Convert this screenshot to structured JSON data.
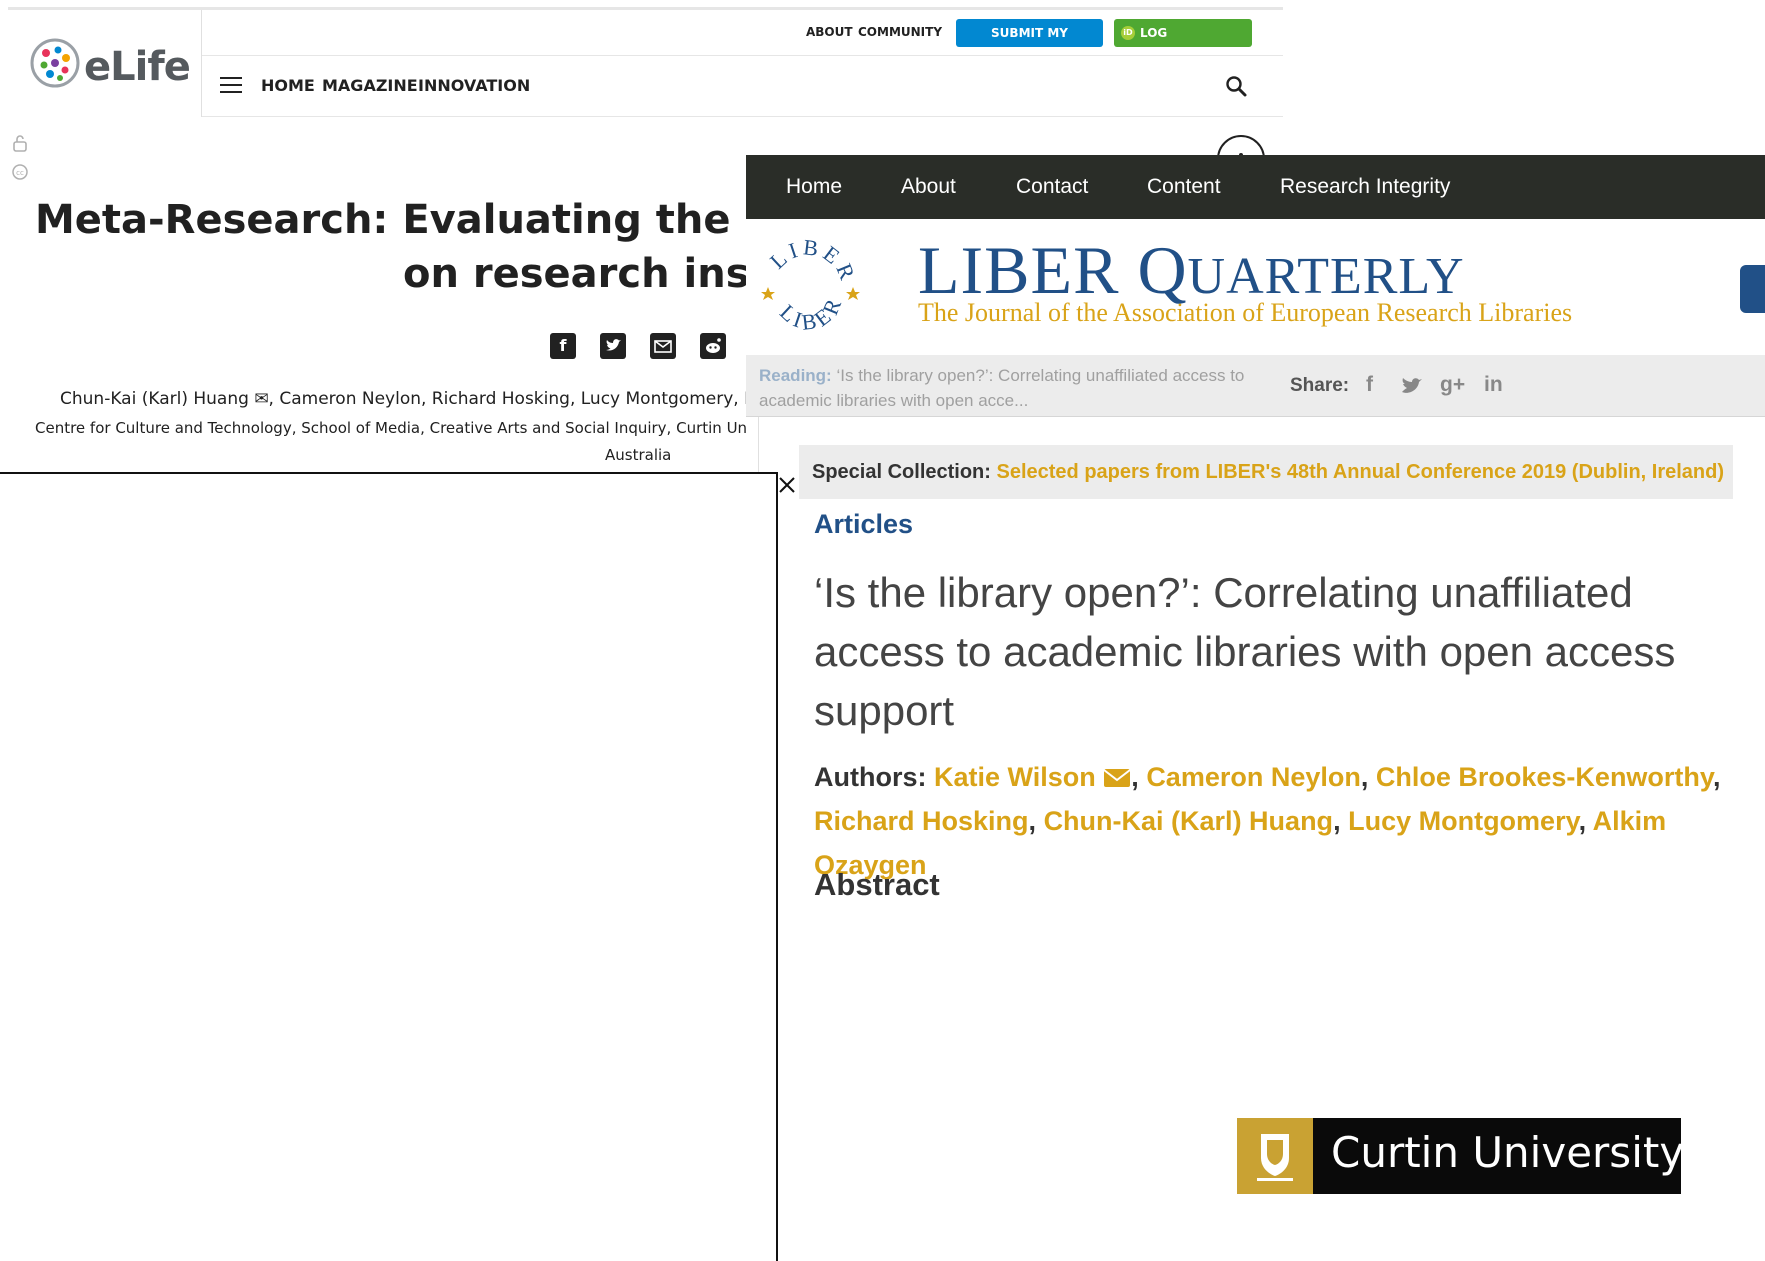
{
  "elife": {
    "logo_text": "eLife",
    "util_links": [
      "ABOUT",
      "COMMUNITY"
    ],
    "submit_label": "SUBMIT MY RESEARCH",
    "login_label": "LOG IN/REGISTER",
    "orcid_badge": "iD",
    "nav": [
      "HOME",
      "MAGAZINE",
      "INNOVATION"
    ],
    "title_line1": "Meta-Research: Evaluating the impa",
    "title_line2": "on research instit",
    "share_icons": [
      "facebook-icon",
      "twitter-icon",
      "email-icon",
      "reddit-icon"
    ],
    "authors": "Chun-Kai (Karl) Huang ✉, Cameron Neylon, Richard Hosking, Lucy Montgomery, K",
    "affiliation": "Centre for Culture and Technology, School of Media, Creative Arts and Social Inquiry, Curtin Univ",
    "affiliation_line2": "Australia",
    "accent_blue": "#0288d1",
    "accent_green": "#4fa832"
  },
  "overlay": {
    "close_icon": "close-icon"
  },
  "liber": {
    "nav": [
      "Home",
      "About",
      "Contact",
      "Content",
      "Research Integrity"
    ],
    "title_big1": "LIBER ",
    "title_q": "Q",
    "title_rest": "UARTERLY",
    "subtitle": "The Journal of the Association of European Research Libraries",
    "seal_text_top": "LIBER",
    "seal_text_bottom": "LIBER",
    "reading_label": "Reading:",
    "reading_text": "‘Is the library open?’: Correlating unaffiliated access to academic libraries with open acce...",
    "share_label": "Share:",
    "share_icons": [
      "f",
      "t",
      "g+",
      "in"
    ],
    "special_label": "Special Collection:",
    "special_link": "Selected papers from LIBER's 48th Annual Conference 2019 (Dublin, Ireland)",
    "section": "Articles",
    "article_title": "‘Is the library open?’: Correlating unaffiliated access to academic libraries with open access support",
    "authors_label": "Authors:",
    "authors": [
      "Katie Wilson",
      "Cameron Neylon",
      "Chloe Brookes-Kenworthy",
      "Richard Hosking",
      "Chun-Kai (Karl) Huang",
      "Lucy Montgomery",
      "Alkim Ozaygen"
    ],
    "abstract_heading": "Abstract",
    "colors": {
      "navy": "#215087",
      "gold": "#d9a318",
      "nav_bg": "#2a2d28"
    }
  },
  "curtin": {
    "name": "Curtin University",
    "color_gold": "#c9a233"
  }
}
